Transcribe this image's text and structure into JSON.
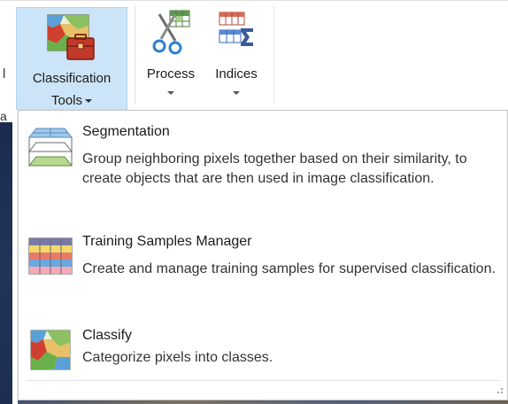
{
  "ribbon": {
    "left_clip": "l",
    "classification_tools": {
      "line1": "Classification",
      "line2": "Tools",
      "icon": "classification-tools-icon"
    },
    "process": {
      "label": "Process",
      "icon": "process-scissors-icon"
    },
    "indices": {
      "label": "Indices",
      "icon": "indices-sum-icon"
    }
  },
  "left_char": "a",
  "menu": {
    "items": [
      {
        "title": "Segmentation",
        "description": "Group neighboring pixels together based on their similarity, to create objects that are then used in image classification.",
        "icon": "segmentation-layers-icon"
      },
      {
        "title": "Training Samples Manager",
        "description": "Create and manage training samples for supervised classification.",
        "icon": "training-samples-table-icon"
      },
      {
        "title": "Classify",
        "description": "Categorize pixels into classes.",
        "icon": "classify-map-icon"
      }
    ]
  },
  "colors": {
    "ribbon_selected_bg": "#cce4f7",
    "menu_border": "#c6c6c6",
    "map_dark": "#1a2b4f"
  }
}
